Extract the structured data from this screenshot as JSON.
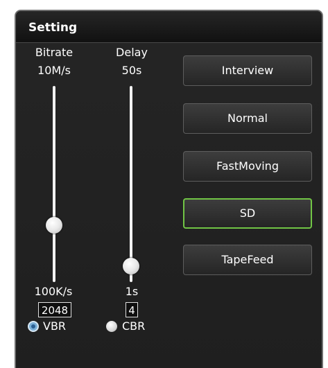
{
  "panel": {
    "title": "Setting"
  },
  "bitrate": {
    "label": "Bitrate",
    "max_label": "10M/s",
    "min_label": "100K/s",
    "value": "2048",
    "level": 0.29
  },
  "delay": {
    "label": "Delay",
    "max_label": "50s",
    "min_label": "1s",
    "value": "4",
    "level": 0.08
  },
  "mode": {
    "vbr_label": "VBR",
    "cbr_label": "CBR",
    "selected": "VBR"
  },
  "presets": {
    "interview": "Interview",
    "normal": "Normal",
    "fastmoving": "FastMoving",
    "sd": "SD",
    "tapefeed": "TapeFeed",
    "active": "SD"
  },
  "colors": {
    "active_border": "#71c545",
    "radio_selected": "#7ab0d8"
  }
}
